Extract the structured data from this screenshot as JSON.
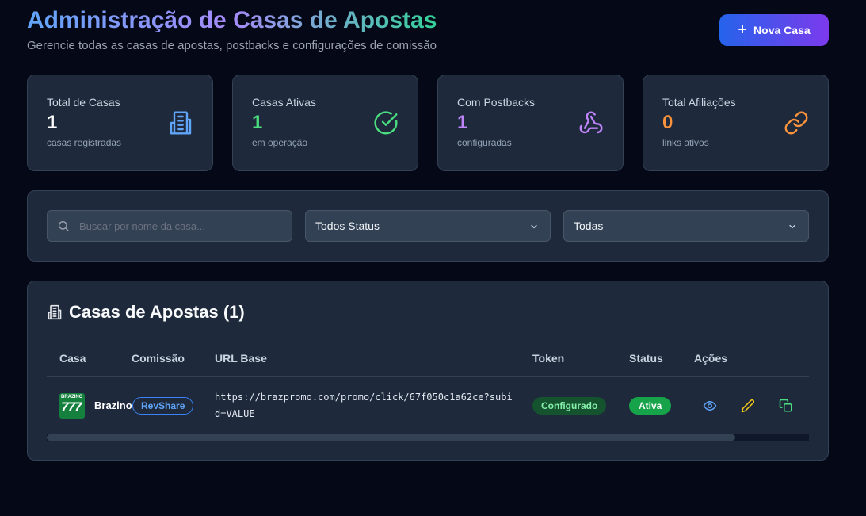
{
  "header": {
    "title": "Administração de Casas de Apostas",
    "subtitle": "Gerencie todas as casas de apostas, postbacks e configurações de comissão",
    "new_button": "Nova Casa"
  },
  "stats": [
    {
      "label": "Total de Casas",
      "value": "1",
      "sub": "casas registradas",
      "icon": "building-icon",
      "color": "#60a5fa"
    },
    {
      "label": "Casas Ativas",
      "value": "1",
      "sub": "em operação",
      "icon": "check-circle-icon",
      "color": "#4ade80"
    },
    {
      "label": "Com Postbacks",
      "value": "1",
      "sub": "configuradas",
      "icon": "webhook-icon",
      "color": "#c084fc"
    },
    {
      "label": "Total Afiliações",
      "value": "0",
      "sub": "links ativos",
      "icon": "link-icon",
      "color": "#fb923c"
    }
  ],
  "filters": {
    "search_placeholder": "Buscar por nome da casa...",
    "status_value": "Todos Status",
    "type_value": "Todas"
  },
  "table": {
    "title": "Casas de Apostas (1)",
    "columns": [
      "Casa",
      "Comissão",
      "URL Base",
      "Token",
      "Status",
      "Ações"
    ],
    "rows": [
      {
        "logo_text_small": "BRAZINO",
        "logo_text": "777",
        "name": "Brazino",
        "commission": "RevShare",
        "url": "https://brazpromo.com/promo/click/67f050c1a62ce?subid=VALUE",
        "token": "Configurado",
        "status": "Ativa"
      }
    ]
  },
  "colors": {
    "accent_blue": "#3b82f6",
    "accent_purple": "#7c3aed",
    "success": "#16a34a"
  }
}
